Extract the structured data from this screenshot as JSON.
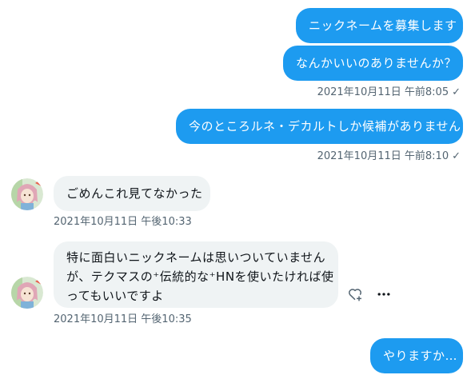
{
  "messages": [
    {
      "text": "ニックネームを募集します"
    },
    {
      "text": "なんかいいのありませんか？"
    },
    {
      "text": "今のところルネ・デカルトしか候補がありません"
    },
    {
      "text": "ごめんこれ見てなかった"
    },
    {
      "lines": [
        "特に面白いニックネームは思いついていません",
        "が、テクマスの⁺伝統的な⁺HNを使いたければ使",
        "ってもいいですよ"
      ]
    },
    {
      "text": "やりますか…"
    }
  ],
  "timestamps": {
    "t1": "2021年10月11日 午前8:05",
    "t2": "2021年10月11日 午前8:10",
    "t3": "2021年10月11日 午後10:33",
    "t4": "2021年10月11日 午後10:35"
  },
  "read_mark": "✓",
  "icons": [
    "avatar",
    "heart-plus-icon",
    "more-icon"
  ],
  "colors": {
    "outgoing": "#1d9bf0",
    "incoming": "#eff3f4",
    "meta": "#536471"
  }
}
